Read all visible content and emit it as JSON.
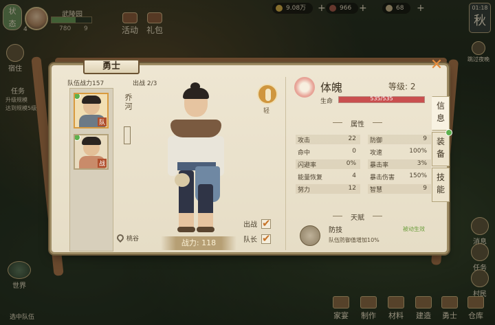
{
  "hud": {
    "badge": "状\n态",
    "player_level": "4",
    "player_name": "武陵园",
    "stat_a": "780",
    "stat_b": "9",
    "btn_activity": "活动",
    "btn_gift": "礼包",
    "res_gold": "9.08万",
    "res_b": "966",
    "res_c": "68",
    "plus": "+",
    "clock_time": "01:18",
    "season": "秋",
    "skip_night": "跳过夜晚"
  },
  "side": {
    "left_top": "宿住",
    "task_title": "任务",
    "task_lines": [
      "升级规模",
      "达到规模5级"
    ],
    "world": "世界",
    "chat": "选中队伍",
    "right_items": [
      "消息",
      "任务",
      "村民"
    ],
    "bottom": [
      "家宴",
      "制作",
      "材料",
      "建造",
      "勇士",
      "仓库"
    ]
  },
  "panel": {
    "title": "勇士",
    "close": "✕",
    "team_power_label": "队伍战力",
    "team_power": "157",
    "deploy_label": "出战",
    "deploy_value": "2/3",
    "cards": [
      {
        "tag": "队",
        "selected": true
      },
      {
        "tag": "战",
        "selected": false
      }
    ],
    "hero_name": "乔河",
    "location": "桃谷",
    "class_label": "轻",
    "power_label": "战力:",
    "power": "118",
    "chk_battle": "出战",
    "chk_leader": "队长",
    "soul_name": "体魄",
    "grade_label": "等级:",
    "grade": "2",
    "hp_label": "生命",
    "hp_text": "535/535",
    "hp_fraction": 1.0,
    "attr_title": "属性",
    "attrs_left": [
      {
        "k": "攻击",
        "v": "22"
      },
      {
        "k": "命中",
        "v": "0"
      },
      {
        "k": "闪避率",
        "v": "0%"
      },
      {
        "k": "能量恢复",
        "v": "4"
      },
      {
        "k": "努力",
        "v": "12"
      }
    ],
    "attrs_right": [
      {
        "k": "防御",
        "v": "9"
      },
      {
        "k": "攻速",
        "v": "100%"
      },
      {
        "k": "暴击率",
        "v": "3%"
      },
      {
        "k": "暴击伤害",
        "v": "150%"
      },
      {
        "k": "智慧",
        "v": "9"
      }
    ],
    "talent_title": "天赋",
    "talent_name": "防技",
    "talent_state": "被动生效",
    "talent_desc": "队伍防御值增加10%",
    "tabs": [
      "信息",
      "装备",
      "技能"
    ]
  },
  "colors": {
    "accent": "#e58b3c",
    "hp": "#c94f4f",
    "green": "#5db04d"
  }
}
